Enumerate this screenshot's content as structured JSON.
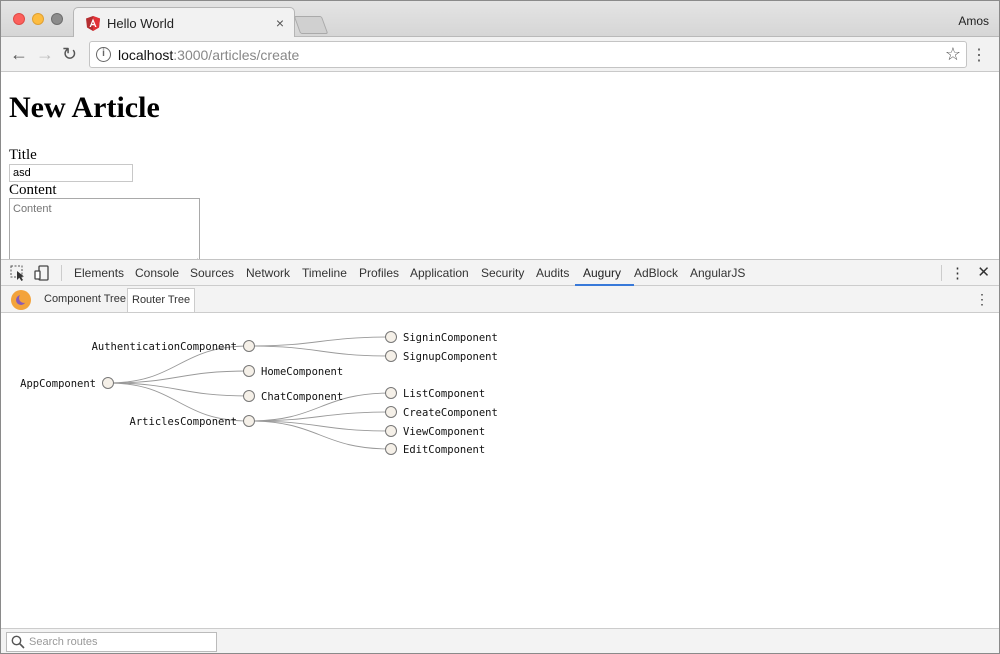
{
  "browser": {
    "tab_title": "Hello World",
    "tab_close": "×",
    "profile_name": "Amos",
    "url_host": "localhost",
    "url_path": ":3000/articles/create"
  },
  "page": {
    "heading": "New Article",
    "title_label": "Title",
    "title_value": "asd",
    "content_label": "Content",
    "content_placeholder": "Content"
  },
  "devtools": {
    "tabs": [
      "Elements",
      "Console",
      "Sources",
      "Network",
      "Timeline",
      "Profiles",
      "Application",
      "Security",
      "Audits",
      "Augury",
      "AdBlock",
      "AngularJS"
    ],
    "active_tab": "Augury",
    "augury_tabs": [
      "Component Tree",
      "Router Tree"
    ],
    "active_augury_tab": "Router Tree",
    "search_placeholder": "Search routes"
  },
  "router_tree": {
    "root": "AppComponent",
    "children": [
      {
        "name": "AuthenticationComponent",
        "children": [
          "SigninComponent",
          "SignupComponent"
        ]
      },
      {
        "name": "HomeComponent",
        "children": []
      },
      {
        "name": "ChatComponent",
        "children": []
      },
      {
        "name": "ArticlesComponent",
        "children": [
          "ListComponent",
          "CreateComponent",
          "ViewComponent",
          "EditComponent"
        ]
      }
    ]
  },
  "colors": {
    "accent": "#3879d9",
    "node_fill": "#f5f0e8",
    "node_stroke": "#777777",
    "link": "#999999"
  }
}
